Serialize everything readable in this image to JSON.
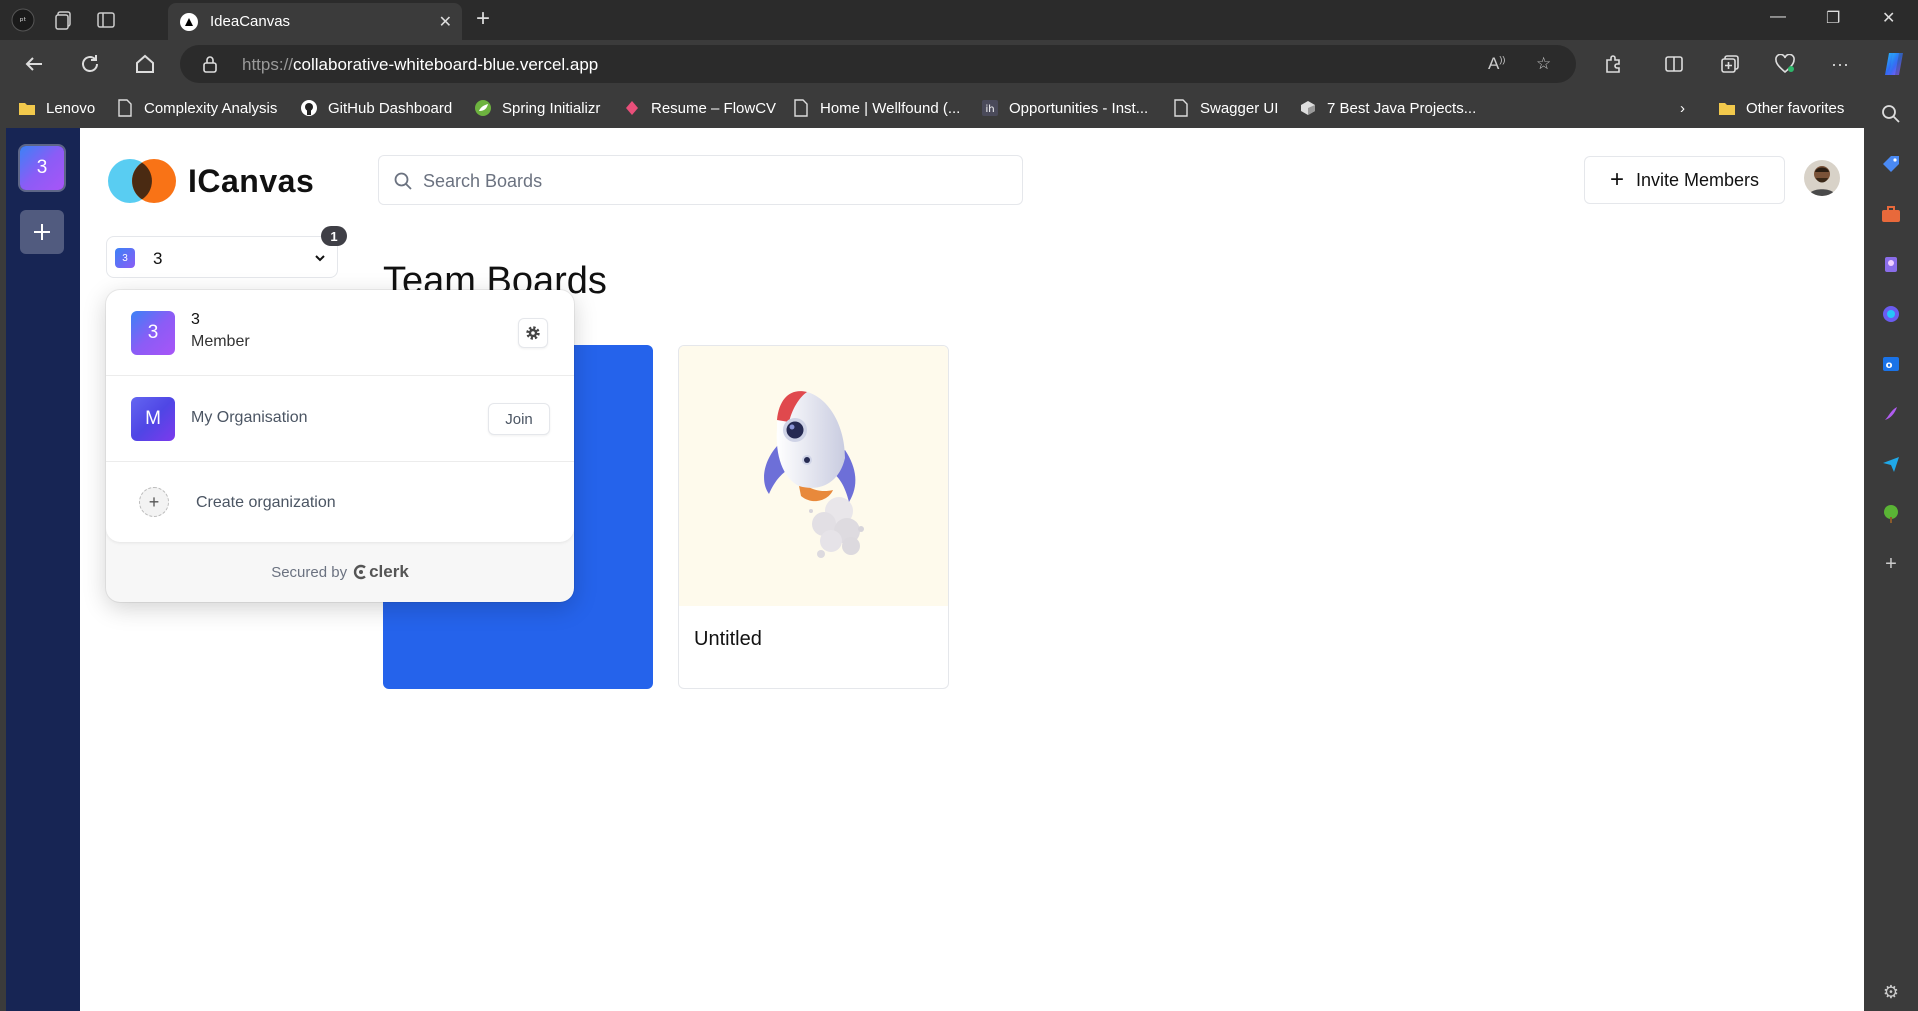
{
  "browser": {
    "tab_title": "IdeaCanvas",
    "url_protocol": "https://",
    "url_host": "collaborative-whiteboard-blue.vercel.app",
    "bookmarks": [
      {
        "label": "Lenovo",
        "icon": "folder-icon"
      },
      {
        "label": "Complexity Analysis",
        "icon": "page-icon"
      },
      {
        "label": "GitHub Dashboard",
        "icon": "github-icon"
      },
      {
        "label": "Spring Initializr",
        "icon": "spring-icon"
      },
      {
        "label": "Resume – FlowCV",
        "icon": "flowcv-icon"
      },
      {
        "label": "Home | Wellfound (...",
        "icon": "page-icon"
      },
      {
        "label": "Opportunities - Inst...",
        "icon": "ih-icon"
      },
      {
        "label": "Swagger UI",
        "icon": "page-icon"
      },
      {
        "label": "7 Best Java Projects...",
        "icon": "cube-icon"
      }
    ],
    "other_favorites": "Other favorites"
  },
  "app": {
    "rail_org_initial": "3",
    "logo_text": "ICanvas",
    "org_switcher_name": "3",
    "org_switcher_initial": "3",
    "notification_count": "1",
    "search_placeholder": "Search Boards",
    "invite_label": "Invite Members",
    "heading": "Team Boards",
    "boards": [
      {
        "title": "Untitled",
        "thumbnail": "rocket-illustration"
      }
    ],
    "colors": {
      "rail": "#172554",
      "board_blue": "#2563eb",
      "org_gradient": [
        "#3b82f6",
        "#a855f7"
      ]
    }
  },
  "dropdown": {
    "active_org_initial": "3",
    "active_org_name": "3",
    "active_org_role": "Member",
    "other_org_initial": "M",
    "other_org_name": "My Organisation",
    "join_label": "Join",
    "create_label": "Create organization",
    "secured_by": "Secured by",
    "clerk_brand": "clerk"
  }
}
